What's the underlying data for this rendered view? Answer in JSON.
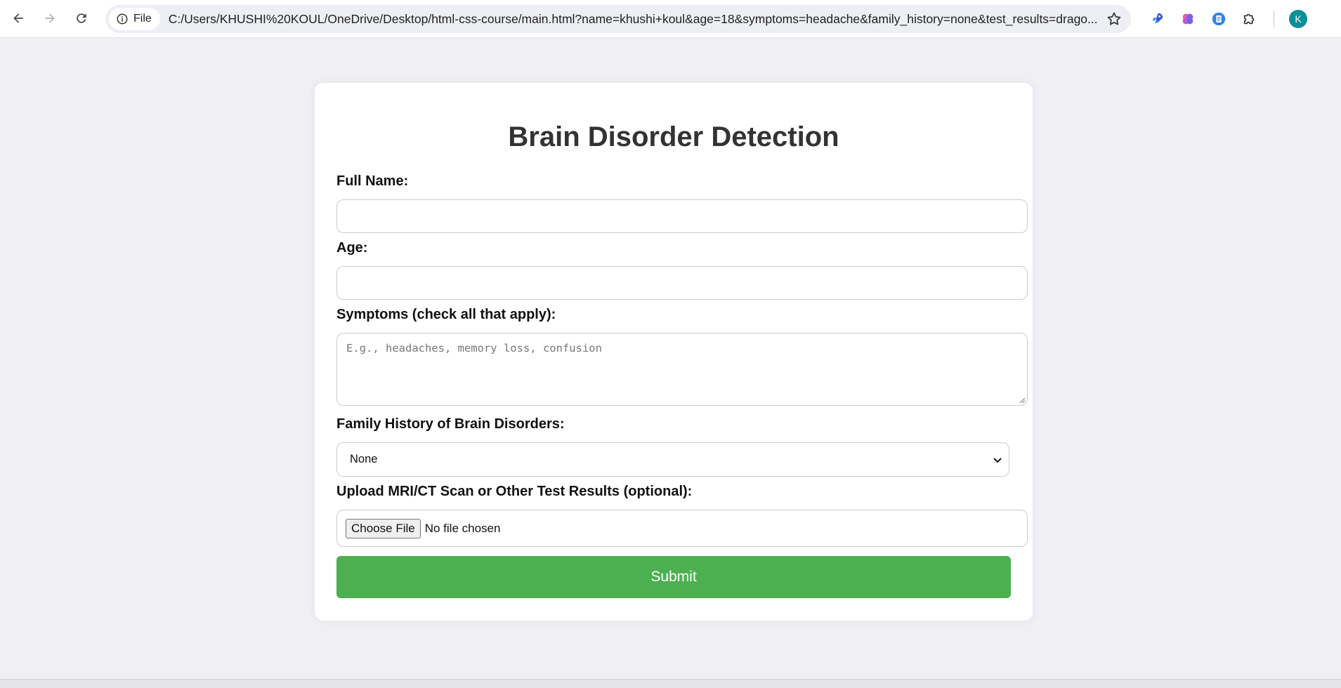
{
  "browser": {
    "site_chip_label": "File",
    "url": "C:/Users/KHUSHI%20KOUL/OneDrive/Desktop/html-css-course/main.html?name=khushi+koul&age=18&symptoms=headache&family_history=none&test_results=drago...",
    "profile_initial": "K"
  },
  "form": {
    "title": "Brain Disorder Detection",
    "name_label": "Full Name:",
    "name_value": "",
    "age_label": "Age:",
    "age_value": "",
    "symptoms_label": "Symptoms (check all that apply):",
    "symptoms_placeholder": "E.g., headaches, memory loss, confusion",
    "family_history_label": "Family History of Brain Disorders:",
    "family_history_value": "None",
    "upload_label": "Upload MRI/CT Scan or Other Test Results (optional):",
    "choose_file_label": "Choose File",
    "file_status": "No file chosen",
    "submit_label": "Submit"
  },
  "colors": {
    "page_background": "#f0f0f4",
    "submit_button": "#4caf50",
    "title_text": "#333333",
    "avatar": "#0b8f9b"
  }
}
